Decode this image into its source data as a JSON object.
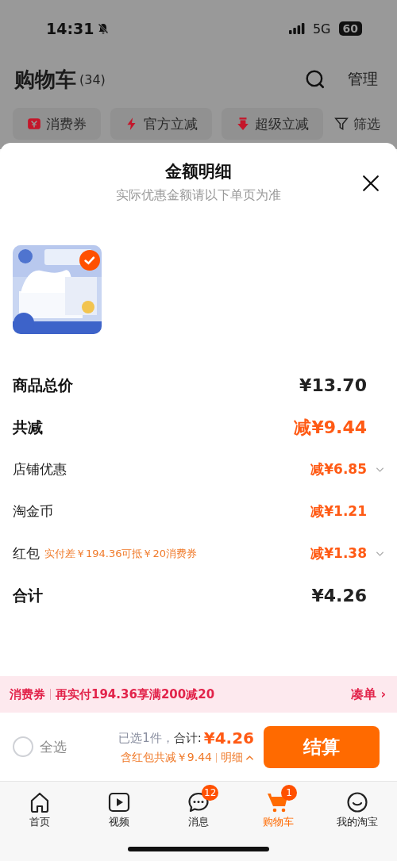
{
  "status_bar": {
    "time": "14:31",
    "network": "5G",
    "battery": "60"
  },
  "header": {
    "title": "购物车",
    "count": "(34)",
    "manage": "管理"
  },
  "filters": [
    {
      "kind": "coupon",
      "label": "消费券"
    },
    {
      "kind": "flash",
      "label": "官方立减"
    },
    {
      "kind": "drop",
      "label": "超级立减"
    },
    {
      "kind": "filter",
      "label": "筛选"
    }
  ],
  "sheet": {
    "title": "金额明细",
    "subtitle": "实际优惠金额请以下单页为准",
    "products": [
      {
        "kind": "picture",
        "selected": true
      }
    ],
    "rows": [
      {
        "label": "商品总价",
        "value": "¥13.70",
        "emphasis": true,
        "discount": false,
        "expandable": false
      },
      {
        "label": "共减",
        "value": "减¥9.44",
        "emphasis": true,
        "discount": true,
        "expandable": false
      },
      {
        "label": "店铺优惠",
        "value": "减¥6.85",
        "emphasis": false,
        "discount": true,
        "expandable": true
      },
      {
        "label": "淘金币",
        "value": "减¥1.21",
        "emphasis": false,
        "discount": true,
        "expandable": false
      },
      {
        "label": "红包",
        "note": "实付差￥194.36可抵￥20消费券",
        "value": "减¥1.38",
        "emphasis": false,
        "discount": true,
        "expandable": true
      },
      {
        "label": "合计",
        "value": "¥4.26",
        "emphasis": true,
        "discount": false,
        "expandable": false
      }
    ]
  },
  "promo": {
    "tag": "消费券",
    "text": "再实付194.36享满200减20",
    "action": "凑单",
    "chevron": "›"
  },
  "checkout": {
    "select_all": {
      "label": "全选",
      "checked": false
    },
    "selected_count": "已选1件，",
    "total_label": "合计:",
    "total": "¥4.26",
    "savings": "含红包共减￥9.44",
    "detail": "明细",
    "button": "结算"
  },
  "tab_bar": [
    {
      "kind": "home",
      "label": "首页",
      "selected": false
    },
    {
      "kind": "video",
      "label": "视频",
      "selected": false
    },
    {
      "kind": "chat",
      "label": "消息",
      "selected": false,
      "badge": "12"
    },
    {
      "kind": "cart",
      "label": "购物车",
      "selected": true,
      "badge": "1"
    },
    {
      "kind": "smile",
      "label": "我的淘宝",
      "selected": false
    }
  ]
}
